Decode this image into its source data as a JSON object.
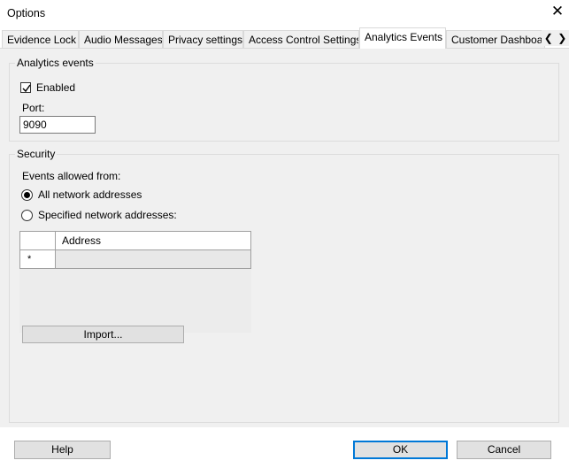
{
  "window": {
    "title": "Options"
  },
  "tabs": [
    {
      "label": "Evidence Lock"
    },
    {
      "label": "Audio Messages"
    },
    {
      "label": "Privacy settings"
    },
    {
      "label": "Access Control Settings"
    },
    {
      "label": "Analytics Events"
    },
    {
      "label": "Customer Dashboard"
    }
  ],
  "analytics_events": {
    "legend": "Analytics events",
    "enabled_label": "Enabled",
    "enabled_checked": true,
    "port_label": "Port:",
    "port_value": "9090"
  },
  "security": {
    "legend": "Security",
    "allowed_from_label": "Events allowed from:",
    "all_label": "All network addresses",
    "specified_label": "Specified network addresses:",
    "selected": "all",
    "grid": {
      "column_header": "Address",
      "new_row_marker": "*"
    },
    "import_label": "Import..."
  },
  "buttons": {
    "help": "Help",
    "ok": "OK",
    "cancel": "Cancel"
  },
  "icons": {
    "close": "close-icon",
    "left": "chevron-left-icon",
    "right": "chevron-right-icon"
  }
}
